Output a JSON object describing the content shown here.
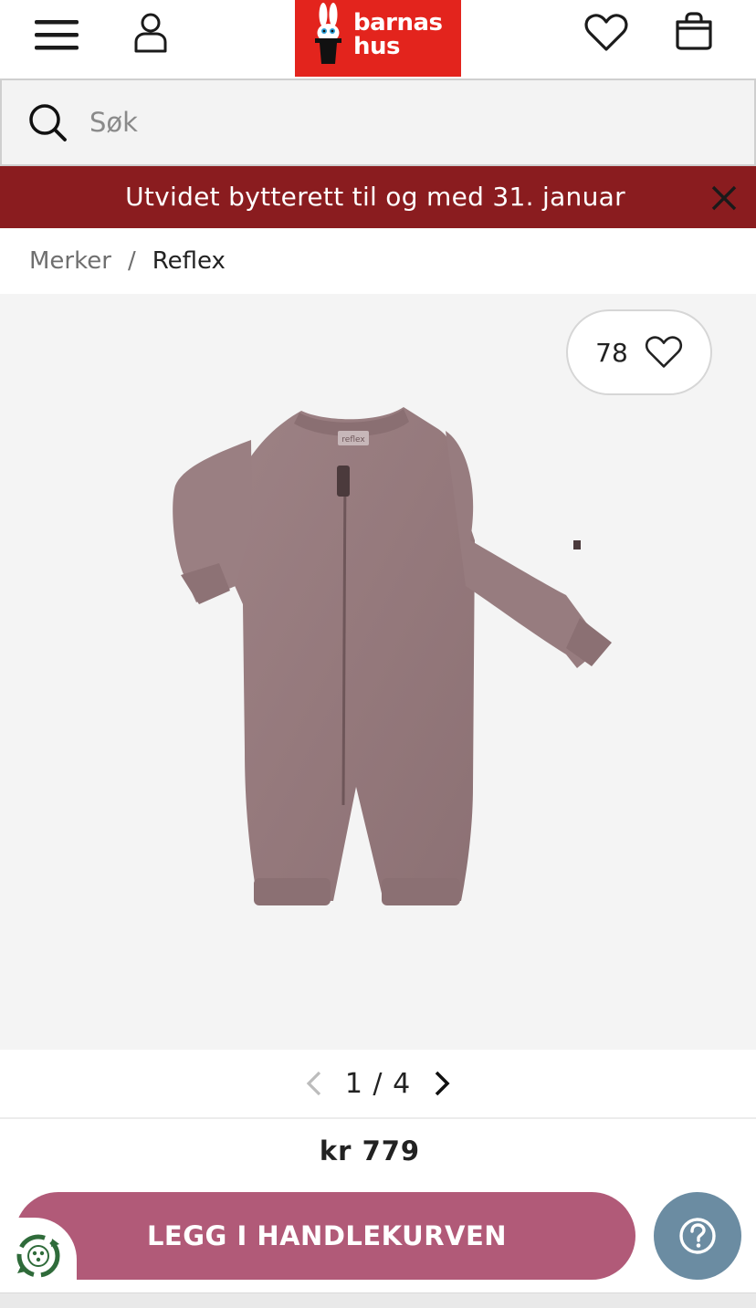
{
  "header": {
    "logo_line1": "barnas",
    "logo_line2": "hus",
    "brand_color": "#e3241d",
    "icons": [
      "menu-icon",
      "user-icon",
      "heart-icon",
      "shopping-bag-icon"
    ]
  },
  "search": {
    "placeholder": "Søk",
    "value": ""
  },
  "banner": {
    "text": "Utvidet bytterett til og med 31. januar",
    "color": "#8a1c1f"
  },
  "breadcrumb": {
    "items": [
      "Merker",
      "Reflex"
    ],
    "separator": "/"
  },
  "gallery": {
    "favorite_count": "78",
    "label_on_garment": "reflex",
    "pager": "1 / 4",
    "current_page": 1,
    "total_pages": 4
  },
  "product": {
    "price": "kr 779"
  },
  "actions": {
    "add_to_cart": "LEGG I HANDLEKURVEN",
    "button_color": "#b15a78",
    "help_color": "#6b8ca2"
  }
}
